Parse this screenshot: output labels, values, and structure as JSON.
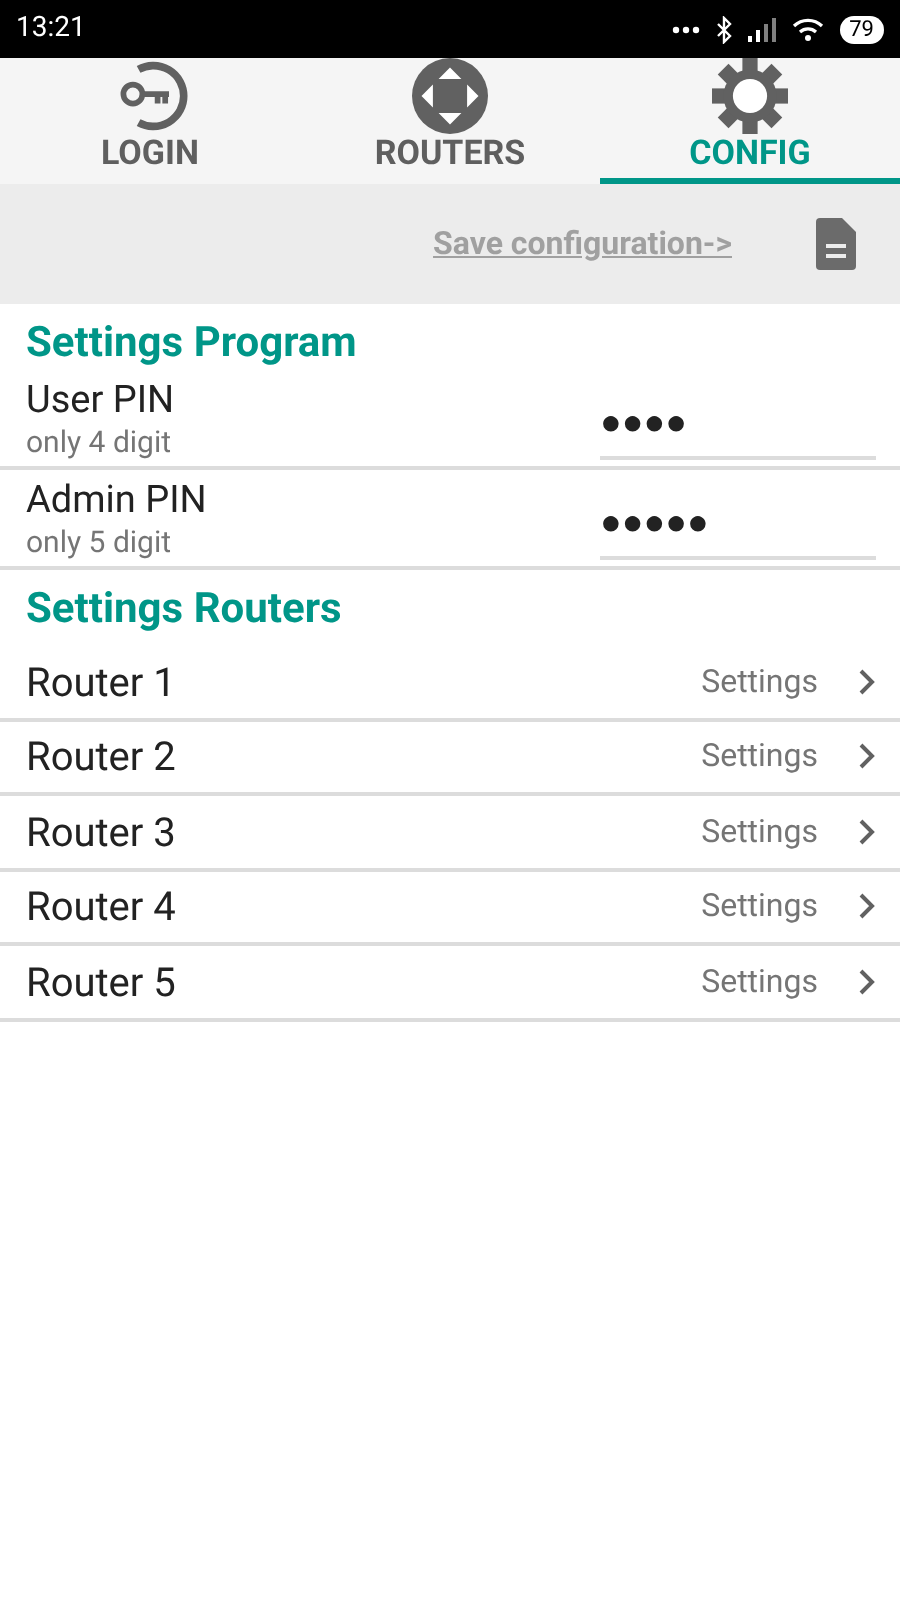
{
  "status_bar": {
    "time": "13:21",
    "battery": "79"
  },
  "tabs": [
    {
      "label": "LOGIN",
      "kind": "key",
      "selected": false
    },
    {
      "label": "ROUTERS",
      "kind": "router",
      "selected": false
    },
    {
      "label": "CONFIG",
      "kind": "gear",
      "selected": true
    }
  ],
  "toolbar": {
    "link": "Save configuration->"
  },
  "program_section": {
    "title": "Settings Program",
    "fields": [
      {
        "label": "User PIN",
        "hint": "only 4 digit",
        "value": "●●●●"
      },
      {
        "label": "Admin PIN",
        "hint": "only 5 digit",
        "value": "●●●●●"
      }
    ]
  },
  "routers_section": {
    "title": "Settings Routers",
    "items": [
      {
        "name": "Router 1",
        "action": "Settings"
      },
      {
        "name": "Router 2",
        "action": "Settings"
      },
      {
        "name": "Router 3",
        "action": "Settings"
      },
      {
        "name": "Router 4",
        "action": "Settings"
      },
      {
        "name": "Router 5",
        "action": "Settings"
      }
    ]
  }
}
